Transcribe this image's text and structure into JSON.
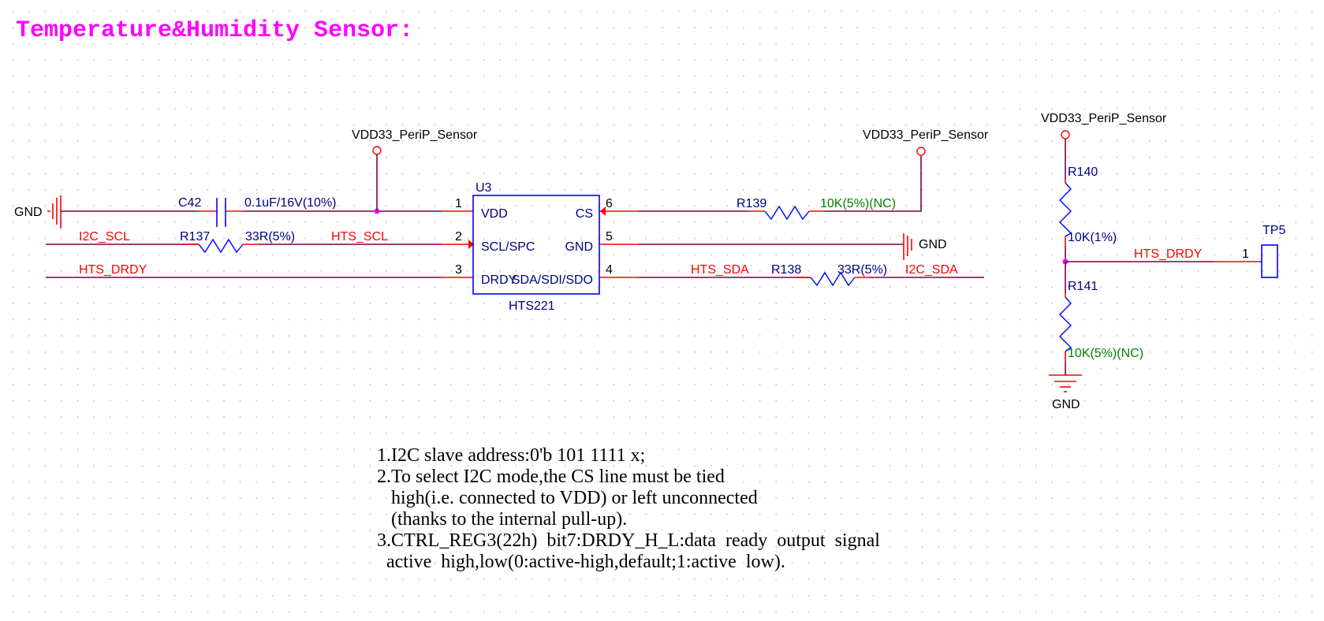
{
  "title": "Temperature&Humidity  Sensor:",
  "power_labels": {
    "vdd_left": "VDD33_PeriP_Sensor",
    "vdd_mid": "VDD33_PeriP_Sensor",
    "vdd_right": "VDD33_PeriP_Sensor"
  },
  "gnd_labels": {
    "left": "GND",
    "mid": "GND",
    "right": "GND"
  },
  "components": {
    "c42": {
      "ref": "C42",
      "value": "0.1uF/16V(10%)"
    },
    "r137": {
      "ref": "R137",
      "value": "33R(5%)"
    },
    "r138": {
      "ref": "R138",
      "value": "33R(5%)"
    },
    "r139": {
      "ref": "R139",
      "value": "10K(5%)(NC)"
    },
    "r140": {
      "ref": "R140",
      "value": "10K(1%)"
    },
    "r141": {
      "ref": "R141",
      "value": "10K(5%)(NC)"
    },
    "u3": {
      "ref": "U3",
      "part": "HTS221",
      "pins": [
        {
          "num": "1",
          "name": "VDD"
        },
        {
          "num": "2",
          "name": "SCL/SPC"
        },
        {
          "num": "3",
          "name": "DRDY"
        },
        {
          "num": "4",
          "name": "SDA/SDI/SDO"
        },
        {
          "num": "5",
          "name": "GND"
        },
        {
          "num": "6",
          "name": "CS"
        }
      ]
    },
    "tp5": {
      "ref": "TP5",
      "pin": "1"
    }
  },
  "nets": {
    "i2c_scl": "I2C_SCL",
    "hts_scl": "HTS_SCL",
    "hts_drdy_left": "HTS_DRDY",
    "hts_sda": "HTS_SDA",
    "i2c_sda": "I2C_SDA",
    "hts_drdy_right": "HTS_DRDY"
  },
  "notes": [
    "1.I2C slave address:0'b 101 1111 x;",
    "2.To select I2C mode,the CS line must be tied",
    "   high(i.e. connected to VDD) or left unconnected",
    "   (thanks to the internal pull-up).",
    "3.CTRL_REG3(22h)  bit7:DRDY_H_L:data  ready  output  signal",
    "  active  high,low(0:active-high,default;1:active  low)."
  ],
  "colors": {
    "title": "#ff00ff",
    "net_label": "#ff0000",
    "designator": "#000080",
    "nc_value": "#008000",
    "wire": "#800040",
    "component": "#0000ff",
    "junction": "#ff00ff"
  }
}
